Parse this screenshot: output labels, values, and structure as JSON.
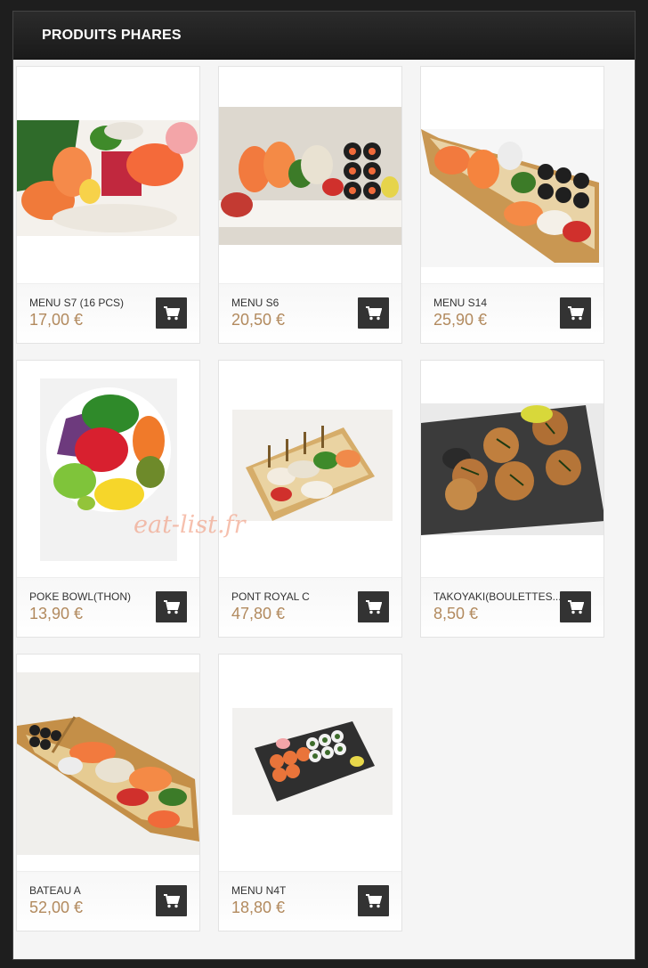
{
  "header": {
    "title": "PRODUITS PHARES"
  },
  "products": [
    {
      "name": "MENU S7 (16 PCS)",
      "price": "17,00 €",
      "image": "sashimi-platter"
    },
    {
      "name": "MENU S6",
      "price": "20,50 €",
      "image": "sushi-plate"
    },
    {
      "name": "MENU S14",
      "price": "25,90 €",
      "image": "sushi-boat"
    },
    {
      "name": "POKE BOWL(THON)",
      "price": "13,90 €",
      "image": "poke-bowl"
    },
    {
      "name": "PONT ROYAL C",
      "price": "47,80 €",
      "image": "sushi-bridge"
    },
    {
      "name": "TAKOYAKI(BOULETTES...",
      "price": "8,50 €",
      "image": "takoyaki"
    },
    {
      "name": "BATEAU A",
      "price": "52,00 €",
      "image": "sushi-boat-large"
    },
    {
      "name": "MENU N4T",
      "price": "18,80 €",
      "image": "maki-slate"
    }
  ],
  "cart_icon": "shopping-cart-icon",
  "watermark": "eat-list.fr",
  "colors": {
    "price": "#b28a5e",
    "header_bg": "#1f1f1f",
    "cart_button": "#333333"
  }
}
